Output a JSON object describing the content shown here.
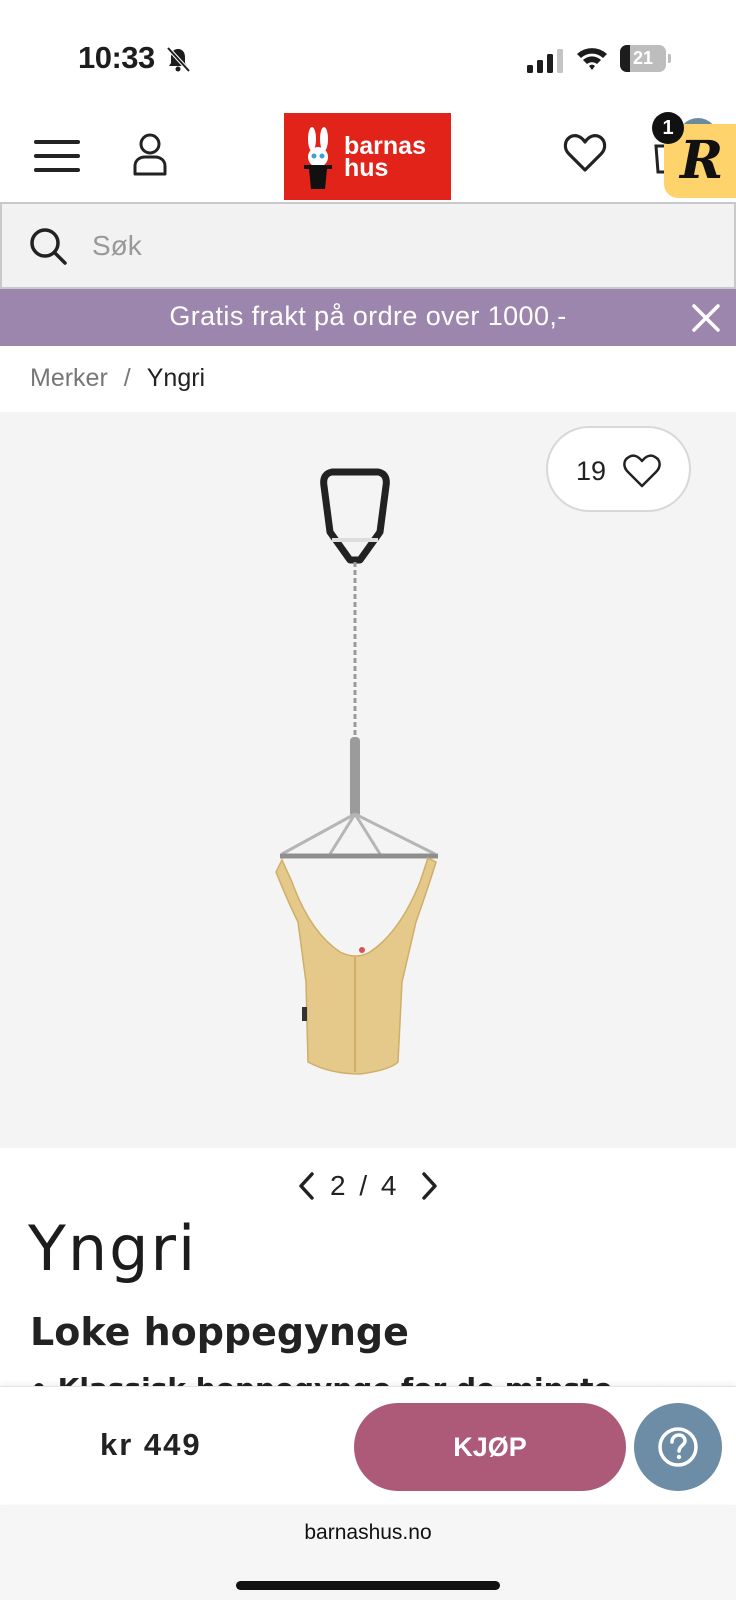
{
  "status_bar": {
    "time": "10:33",
    "battery_level": "21",
    "battery_fraction": 0.21,
    "icons": [
      "bell-muted-icon",
      "cellular-signal-icon",
      "wifi-icon",
      "battery-icon"
    ]
  },
  "header": {
    "logo_line1": "barnas",
    "logo_line2": "hus",
    "cart_count": "1",
    "icons": [
      "menu-icon",
      "user-icon",
      "heart-icon",
      "cart-icon"
    ],
    "brand_color": "#e2231a"
  },
  "search": {
    "placeholder": "Søk"
  },
  "promo": {
    "text": "Gratis frakt på ordre over 1000,-",
    "background": "#9c86ae"
  },
  "breadcrumb": {
    "items": [
      "Merker",
      "Yngri"
    ]
  },
  "gallery": {
    "favorite_count": "19",
    "current": "2",
    "total": "4",
    "pager_text": "2 / 4"
  },
  "product": {
    "brand": "Yngri",
    "title": "Loke hoppegynge",
    "description_partial": "• Klassisk hoppegynge for de minste"
  },
  "buy_bar": {
    "price": "kr 449",
    "buy_label": "KJØP",
    "buy_color": "#ad5a78",
    "help_color": "#6c8da5"
  },
  "browser": {
    "url": "barnashus.no"
  }
}
